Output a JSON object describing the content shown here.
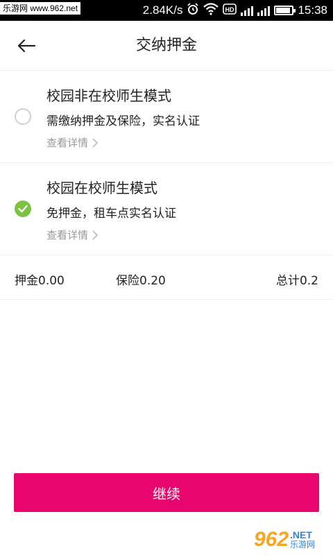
{
  "status_bar": {
    "watermark": "乐游网 www.962.net",
    "speed": "2.84K/s",
    "time": "15:38"
  },
  "header": {
    "title": "交纳押金"
  },
  "options": [
    {
      "title": "校园非在校师生模式",
      "desc": "需缴纳押金及保险，实名认证",
      "link": "查看详情",
      "selected": false
    },
    {
      "title": "校园在校师生模式",
      "desc": "免押金，租车点实名认证",
      "link": "查看详情",
      "selected": true
    }
  ],
  "summary": {
    "deposit": "押金0.00",
    "insurance": "保险0.20",
    "total": "总计0.2"
  },
  "continue_label": "继续",
  "watermark_br": {
    "number": "962",
    "net": ".NET",
    "cn": "乐游网"
  },
  "colors": {
    "accent": "#e8066e",
    "check": "#7cc242",
    "muted": "#999999"
  },
  "icons": {
    "back": "arrow-left-icon",
    "check": "check-icon",
    "chevron": "chevron-right-icon"
  }
}
